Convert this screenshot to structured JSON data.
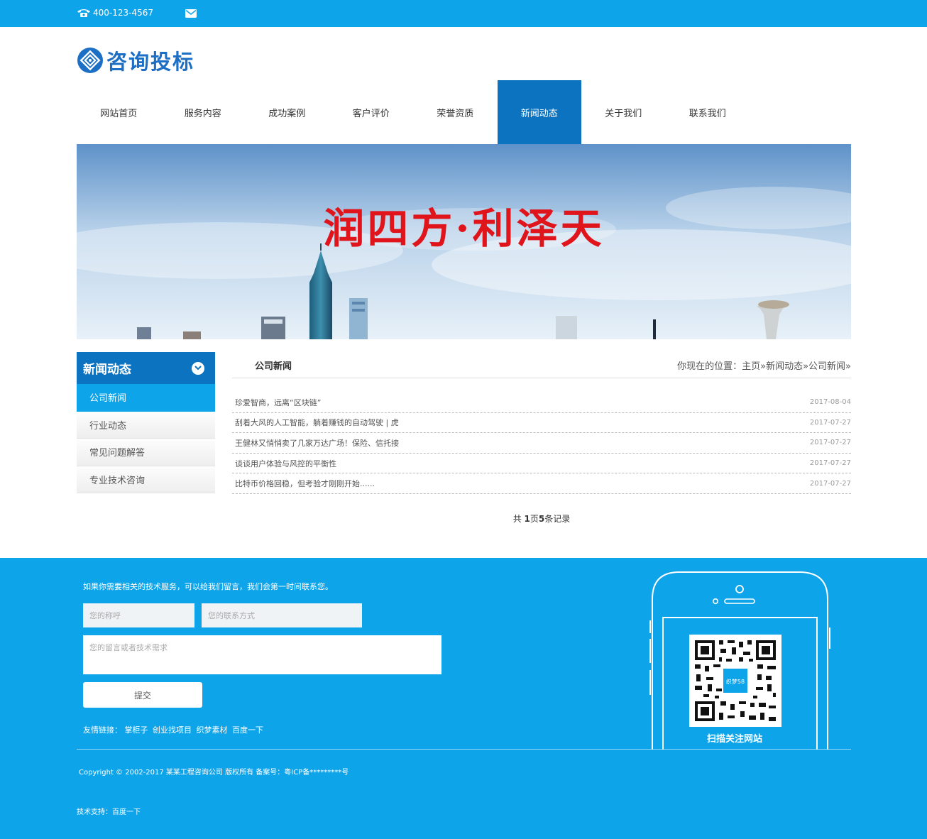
{
  "topbar": {
    "phone": "400-123-4567"
  },
  "logo": {
    "name": "咨询投标"
  },
  "nav": [
    {
      "label": "网站首页"
    },
    {
      "label": "服务内容"
    },
    {
      "label": "成功案例"
    },
    {
      "label": "客户评价"
    },
    {
      "label": "荣誉资质"
    },
    {
      "label": "新闻动态",
      "active": true
    },
    {
      "label": "关于我们"
    },
    {
      "label": "联系我们"
    }
  ],
  "banner": {
    "slogan": "润四方·利泽天"
  },
  "sidebar": {
    "title": "新闻动态",
    "items": [
      {
        "label": "公司新闻",
        "active": true
      },
      {
        "label": "行业动态"
      },
      {
        "label": "常见问题解答"
      },
      {
        "label": "专业技术咨询"
      }
    ]
  },
  "main": {
    "title": "公司新闻",
    "breadcrumb": "你现在的位置：主页»新闻动态»公司新闻»",
    "news": [
      {
        "title": "珍爱智商，远离“区块链”",
        "date": "2017-08-04"
      },
      {
        "title": "刮着大风的人工智能，躺着赚钱的自动驾驶 | 虎",
        "date": "2017-07-27"
      },
      {
        "title": "王健林又悄悄卖了几家万达广场！保险、信托接",
        "date": "2017-07-27"
      },
      {
        "title": "谈谈用户体验与风控的平衡性",
        "date": "2017-07-27"
      },
      {
        "title": "比特币价格回稳，但考验才刚刚开始......",
        "date": "2017-07-27"
      }
    ],
    "pager": {
      "prefix": "共 ",
      "pages": "1",
      "pages_unit": "页",
      "records": "5",
      "records_unit": "条记录"
    }
  },
  "footer": {
    "intro": "如果你需要相关的技术服务，可以给我们留言，我们会第一时间联系您。",
    "name_placeholder": "您的称呼",
    "contact_placeholder": "您的联系方式",
    "message_placeholder": "您的留言或者技术需求",
    "submit_label": "提交",
    "links_label": "友情链接：",
    "links": [
      "掌柜子",
      "创业找项目",
      "织梦素材",
      "百度一下"
    ],
    "copyright": "Copyright © 2002-2017 某某工程咨询公司 版权所有   备案号：粤ICP备*********号",
    "tech_label": "技术支持：",
    "tech_link": "百度一下",
    "qr_center_text": "织梦58",
    "qr_label": "扫描关注网站"
  },
  "colors": {
    "topbar": "#0ea4ea",
    "nav_active": "#0c73c0",
    "slogan": "#e0151c",
    "footer": "#0ea4ea"
  },
  "icons": {
    "phone": "telephone-icon",
    "mail": "envelope-icon",
    "logo": "logo-emblem-icon",
    "sidebar_toggle": "chevron-down-icon"
  }
}
